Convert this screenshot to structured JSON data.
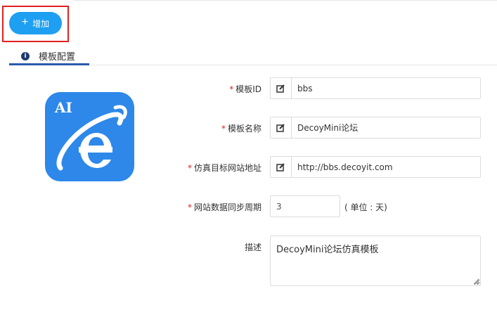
{
  "toolbar": {
    "add_label": "增加",
    "add_icon": "plus-icon"
  },
  "tabs": [
    {
      "label": "模板配置",
      "icon": "info-icon",
      "active": true
    }
  ],
  "logo": {
    "text": "AI",
    "icon": "ie-browser-icon",
    "color": "#2d88e9"
  },
  "form": {
    "template_id": {
      "label": "模板ID",
      "required": true,
      "value": "bbs",
      "icon": "edit-icon"
    },
    "template_name": {
      "label": "模板名称",
      "required": true,
      "value": "DecoyMini论坛",
      "icon": "edit-icon"
    },
    "target_url": {
      "label": "仿真目标网站地址",
      "required": true,
      "value": "http://bbs.decoyit.com",
      "icon": "edit-icon"
    },
    "sync_period": {
      "label": "网站数据同步周期",
      "required": true,
      "value": "3",
      "unit": "( 单位 : 天)"
    },
    "description": {
      "label": "描述",
      "required": false,
      "value": "DecoyMini论坛仿真模板"
    }
  },
  "colors": {
    "accent": "#1e9ff2",
    "highlight_border": "#e02020",
    "tab_underline": "#2b5aa8"
  }
}
